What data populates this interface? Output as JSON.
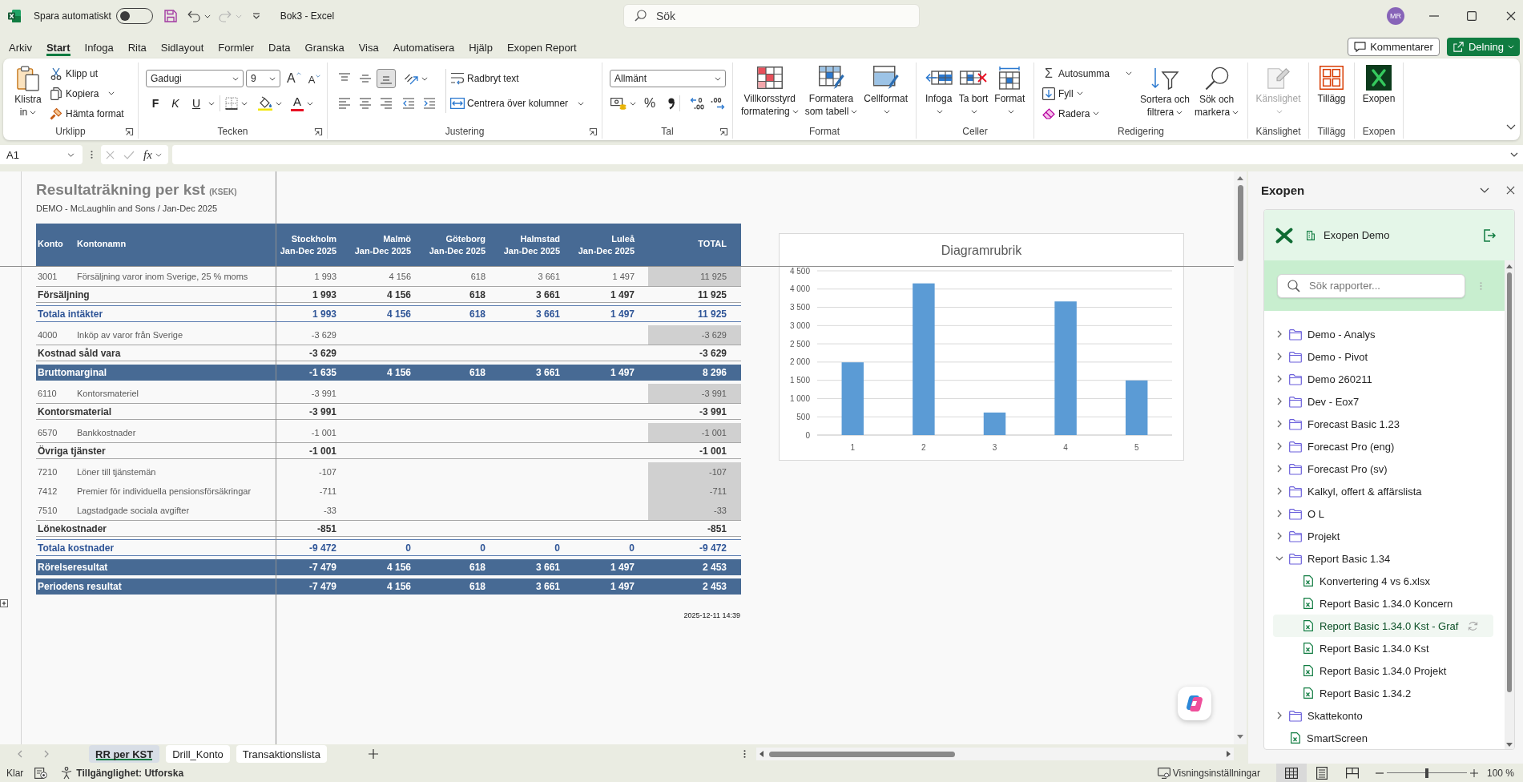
{
  "title_bar": {
    "autosave_label": "Spara automatiskt",
    "autosave_on": false,
    "quick_access": [
      {
        "kind": "save",
        "disabled": false
      },
      {
        "kind": "undo",
        "disabled": false
      },
      {
        "kind": "redo",
        "disabled": true
      },
      {
        "kind": "customize",
        "disabled": false
      }
    ],
    "document_title": "Bok3 - Excel",
    "search": {
      "placeholder": "Sök"
    },
    "user_initials": "MR"
  },
  "menu_tabs": [
    {
      "label": "Arkiv",
      "selected": false
    },
    {
      "label": "Start",
      "selected": true
    },
    {
      "label": "Infoga",
      "selected": false
    },
    {
      "label": "Rita",
      "selected": false
    },
    {
      "label": "Sidlayout",
      "selected": false
    },
    {
      "label": "Formler",
      "selected": false
    },
    {
      "label": "Data",
      "selected": false
    },
    {
      "label": "Granska",
      "selected": false
    },
    {
      "label": "Visa",
      "selected": false
    },
    {
      "label": "Automatisera",
      "selected": false
    },
    {
      "label": "Hjälp",
      "selected": false
    },
    {
      "label": "Exopen Report",
      "selected": false
    }
  ],
  "header_buttons": [
    {
      "kind": "comments",
      "label": "Kommentarer"
    },
    {
      "kind": "share",
      "label": "Delning"
    }
  ],
  "ribbon": {
    "groups": [
      {
        "kind": "clipboard",
        "label": "Urklipp",
        "launcher": true,
        "paste": {
          "label_lines": [
            "Klistra",
            "in"
          ],
          "dropdown": true
        },
        "commands": [
          {
            "kind": "cut",
            "label": "Klipp ut",
            "dropdown": false
          },
          {
            "kind": "copy",
            "label": "Kopiera",
            "dropdown": true
          },
          {
            "kind": "painter",
            "label": "Hämta format",
            "dropdown": false
          }
        ]
      },
      {
        "kind": "font",
        "label": "Tecken",
        "launcher": true,
        "font_name": "Gadugi",
        "font_size": "9",
        "size_buttons": [
          {
            "kind": "grow",
            "glyph": "A"
          },
          {
            "kind": "shrink",
            "glyph": "A"
          }
        ],
        "style_buttons": [
          {
            "kind": "bold",
            "glyph": "F",
            "dropdown": false
          },
          {
            "kind": "italic",
            "glyph": "K",
            "dropdown": false
          },
          {
            "kind": "underline",
            "glyph": "U",
            "dropdown": true
          }
        ],
        "font_color_glyph": "A"
      },
      {
        "kind": "alignment",
        "label": "Justering",
        "launcher": true,
        "vertical": [
          {
            "kind": "top",
            "selected": false
          },
          {
            "kind": "middle",
            "selected": false
          },
          {
            "kind": "bottom",
            "selected": true
          }
        ],
        "horizontal": [
          {
            "kind": "left",
            "selected": false
          },
          {
            "kind": "center",
            "selected": false
          },
          {
            "kind": "right",
            "selected": false
          }
        ],
        "commands": [
          {
            "kind": "wrap",
            "label": "Radbryt text",
            "dropdown": false
          },
          {
            "kind": "merge",
            "label": "Centrera över kolumner",
            "dropdown": true
          }
        ]
      },
      {
        "kind": "number",
        "label": "Tal",
        "launcher": true,
        "format": "Allmänt",
        "percent_glyph": "%"
      },
      {
        "kind": "buttons",
        "label": "Format",
        "launcher": false,
        "buttons": [
          {
            "kind": "conditional",
            "label_lines": [
              "Villkorsstyrd",
              "formatering"
            ],
            "dropdown": true,
            "disabled": false
          },
          {
            "kind": "table_style",
            "label_lines": [
              "Formatera",
              "som tabell"
            ],
            "dropdown": true,
            "disabled": false
          },
          {
            "kind": "cell_style",
            "label_lines": [
              "Cellformat"
            ],
            "dropdown": true,
            "disabled": false
          }
        ]
      },
      {
        "kind": "buttons",
        "label": "Celler",
        "launcher": false,
        "buttons": [
          {
            "kind": "insert",
            "label_lines": [
              "Infoga"
            ],
            "dropdown": true,
            "disabled": false
          },
          {
            "kind": "delete",
            "label_lines": [
              "Ta bort"
            ],
            "dropdown": true,
            "disabled": false
          },
          {
            "kind": "format_cells",
            "label_lines": [
              "Format"
            ],
            "dropdown": true,
            "disabled": false
          }
        ]
      },
      {
        "kind": "editing",
        "label": "Redigering",
        "launcher": false,
        "commands": [
          {
            "kind": "autosum",
            "glyph": "Σ",
            "label": "Autosumma",
            "dropdown": true
          },
          {
            "kind": "fill",
            "label": "Fyll",
            "dropdown": true
          },
          {
            "kind": "clear",
            "label": "Radera",
            "dropdown": true
          }
        ],
        "buttons": [
          {
            "kind": "sort_filter",
            "label_lines": [
              "Sortera och",
              "filtrera"
            ],
            "dropdown": true,
            "disabled": false
          },
          {
            "kind": "find",
            "label_lines": [
              "Sök och",
              "markera"
            ],
            "dropdown": true,
            "disabled": false
          }
        ]
      },
      {
        "kind": "buttons",
        "label": "Känslighet",
        "launcher": false,
        "buttons": [
          {
            "kind": "sensitivity",
            "label_lines": [
              "Känslighet"
            ],
            "dropdown": true,
            "disabled": true
          }
        ]
      },
      {
        "kind": "buttons",
        "label": "Tillägg",
        "launcher": false,
        "buttons": [
          {
            "kind": "add_ins",
            "label_lines": [
              "Tillägg"
            ],
            "dropdown": false,
            "disabled": false
          }
        ]
      },
      {
        "kind": "buttons",
        "label": "Exopen",
        "launcher": false,
        "buttons": [
          {
            "kind": "exopen",
            "label_lines": [
              "Exopen"
            ],
            "dropdown": false,
            "disabled": false
          }
        ]
      }
    ]
  },
  "formula_bar": {
    "name_box": "A1",
    "function_glyph": "fx"
  },
  "report": {
    "title": "Resultaträkning per kst",
    "unit": "(KSEK)",
    "subtitle": "DEMO - McLaughlin and Sons / Jan-Dec 2025",
    "columns": [
      {
        "title": "Konto"
      },
      {
        "title": "Kontonamn"
      },
      {
        "title": "Stockholm",
        "period": "Jan-Dec 2025"
      },
      {
        "title": "Malmö",
        "period": "Jan-Dec 2025"
      },
      {
        "title": "Göteborg",
        "period": "Jan-Dec 2025"
      },
      {
        "title": "Halmstad",
        "period": "Jan-Dec 2025"
      },
      {
        "title": "Luleå",
        "period": "Jan-Dec 2025"
      },
      {
        "title": "TOTAL"
      }
    ],
    "rows": [
      {
        "kind": "detail",
        "account": "3001",
        "name": "Försäljning varor inom Sverige, 25 % moms",
        "values": [
          "1 993",
          "4 156",
          "618",
          "3 661",
          "1 497"
        ],
        "total": "11 925"
      },
      {
        "kind": "subtotal",
        "name": "Försäljning",
        "values": [
          "1 993",
          "4 156",
          "618",
          "3 661",
          "1 497"
        ],
        "total": "11 925"
      },
      {
        "kind": "total",
        "name": "Totala intäkter",
        "values": [
          "1 993",
          "4 156",
          "618",
          "3 661",
          "1 497"
        ],
        "total": "11 925"
      },
      {
        "kind": "detail",
        "account": "4000",
        "name": "Inköp av varor från Sverige",
        "values": [
          "-3 629"
        ],
        "total": "-3 629"
      },
      {
        "kind": "subtotal",
        "name": "Kostnad såld vara",
        "values": [
          "-3 629"
        ],
        "total": "-3 629"
      },
      {
        "kind": "highlight",
        "name": "Bruttomarginal",
        "values": [
          "-1 635",
          "4 156",
          "618",
          "3 661",
          "1 497"
        ],
        "total": "8 296"
      },
      {
        "kind": "detail",
        "account": "6110",
        "name": "Kontorsmateriel",
        "values": [
          "-3 991"
        ],
        "total": "-3 991"
      },
      {
        "kind": "subtotal",
        "name": "Kontorsmaterial",
        "values": [
          "-3 991"
        ],
        "total": "-3 991"
      },
      {
        "kind": "detail",
        "account": "6570",
        "name": "Bankkostnader",
        "values": [
          "-1 001"
        ],
        "total": "-1 001"
      },
      {
        "kind": "subtotal",
        "name": "Övriga tjänster",
        "values": [
          "-1 001"
        ],
        "total": "-1 001"
      },
      {
        "kind": "detail",
        "account": "7210",
        "name": "Löner till tjänstemän",
        "values": [
          "-107"
        ],
        "total": "-107"
      },
      {
        "kind": "detail",
        "account": "7412",
        "name": "Premier för individuella pensionsförsäkringar",
        "values": [
          "-711"
        ],
        "total": "-711"
      },
      {
        "kind": "detail",
        "account": "7510",
        "name": "Lagstadgade sociala avgifter",
        "values": [
          "-33"
        ],
        "total": "-33"
      },
      {
        "kind": "subtotal",
        "name": "Lönekostnader",
        "values": [
          "-851"
        ],
        "total": "-851"
      },
      {
        "kind": "total",
        "name": "Totala kostnader",
        "values": [
          "-9 472",
          "0",
          "0",
          "0",
          "0"
        ],
        "total": "-9 472"
      },
      {
        "kind": "highlight",
        "name": "Rörelseresultat",
        "values": [
          "-7 479",
          "4 156",
          "618",
          "3 661",
          "1 497"
        ],
        "total": "2 453"
      },
      {
        "kind": "highlight",
        "name": "Periodens resultat",
        "values": [
          "-7 479",
          "4 156",
          "618",
          "3 661",
          "1 497"
        ],
        "total": "2 453"
      }
    ],
    "timestamp": "2025-12-11 14:39"
  },
  "chart": {
    "chart_data": {
      "type": "bar",
      "title": "Diagramrubrik",
      "categories": [
        "1",
        "2",
        "3",
        "4",
        "5"
      ],
      "values": [
        1993,
        4156,
        618,
        3661,
        1497
      ],
      "ylim": [
        0,
        4500
      ],
      "grid": true,
      "yticks": [
        {
          "value": 0,
          "label": "0"
        },
        {
          "value": 500,
          "label": "500"
        },
        {
          "value": 1000,
          "label": "1 000"
        },
        {
          "value": 1500,
          "label": "1 500"
        },
        {
          "value": 2000,
          "label": "2 000"
        },
        {
          "value": 2500,
          "label": "2 500"
        },
        {
          "value": 3000,
          "label": "3 000"
        },
        {
          "value": 3500,
          "label": "3 500"
        },
        {
          "value": 4000,
          "label": "4 000"
        },
        {
          "value": 4500,
          "label": "4 500"
        }
      ]
    }
  },
  "sheet_tabs": [
    {
      "label": "RR per KST",
      "selected": true
    },
    {
      "label": "Drill_Konto",
      "selected": false
    },
    {
      "label": "Transaktionslista",
      "selected": false
    }
  ],
  "panel": {
    "title": "Exopen",
    "company": "Exopen Demo",
    "search": {
      "placeholder": "Sök rapporter..."
    },
    "tree": [
      {
        "kind": "folder",
        "label": "Demo - Analys",
        "expanded": false,
        "selected": false,
        "refreshing": false
      },
      {
        "kind": "folder",
        "label": "Demo - Pivot",
        "expanded": false,
        "selected": false,
        "refreshing": false
      },
      {
        "kind": "folder",
        "label": "Demo 260211",
        "expanded": false,
        "selected": false,
        "refreshing": false
      },
      {
        "kind": "folder",
        "label": "Dev - Eox7",
        "expanded": false,
        "selected": false,
        "refreshing": false
      },
      {
        "kind": "folder",
        "label": "Forecast Basic 1.23",
        "expanded": false,
        "selected": false,
        "refreshing": false
      },
      {
        "kind": "folder",
        "label": "Forecast Pro (eng)",
        "expanded": false,
        "selected": false,
        "refreshing": false
      },
      {
        "kind": "folder",
        "label": "Forecast Pro (sv)",
        "expanded": false,
        "selected": false,
        "refreshing": false
      },
      {
        "kind": "folder",
        "label": "Kalkyl, offert & affärslista",
        "expanded": false,
        "selected": false,
        "refreshing": false
      },
      {
        "kind": "folder",
        "label": "O L",
        "expanded": false,
        "selected": false,
        "refreshing": false
      },
      {
        "kind": "folder",
        "label": "Projekt",
        "expanded": false,
        "selected": false,
        "refreshing": false
      },
      {
        "kind": "folder",
        "label": "Report Basic 1.34",
        "expanded": true,
        "selected": false,
        "refreshing": false,
        "children": [
          {
            "kind": "file",
            "label": "Konvertering 4 vs 6.xlsx",
            "selected": false,
            "refreshing": false
          },
          {
            "kind": "file",
            "label": "Report Basic 1.34.0 Koncern",
            "selected": false,
            "refreshing": false
          },
          {
            "kind": "file",
            "label": "Report Basic 1.34.0 Kst - Graf",
            "selected": true,
            "refreshing": true
          },
          {
            "kind": "file",
            "label": "Report Basic 1.34.0 Kst",
            "selected": false,
            "refreshing": false
          },
          {
            "kind": "file",
            "label": "Report Basic 1.34.0 Projekt",
            "selected": false,
            "refreshing": false
          },
          {
            "kind": "file",
            "label": "Report Basic 1.34.2",
            "selected": false,
            "refreshing": false
          }
        ]
      },
      {
        "kind": "folder",
        "label": "Skattekonto",
        "expanded": false,
        "selected": false,
        "refreshing": false
      },
      {
        "kind": "file",
        "label": "SmartScreen",
        "selected": false,
        "refreshing": false
      }
    ]
  },
  "status_bar": {
    "mode": "Klar",
    "accessibility": "Tillgänglighet: Utforska",
    "display_settings": "Visningsinställningar",
    "views": [
      {
        "kind": "normal",
        "selected": true
      },
      {
        "kind": "page_layout",
        "selected": false
      },
      {
        "kind": "page_break",
        "selected": false
      }
    ],
    "zoom": {
      "level": 0.5,
      "reading": "100 %"
    }
  }
}
